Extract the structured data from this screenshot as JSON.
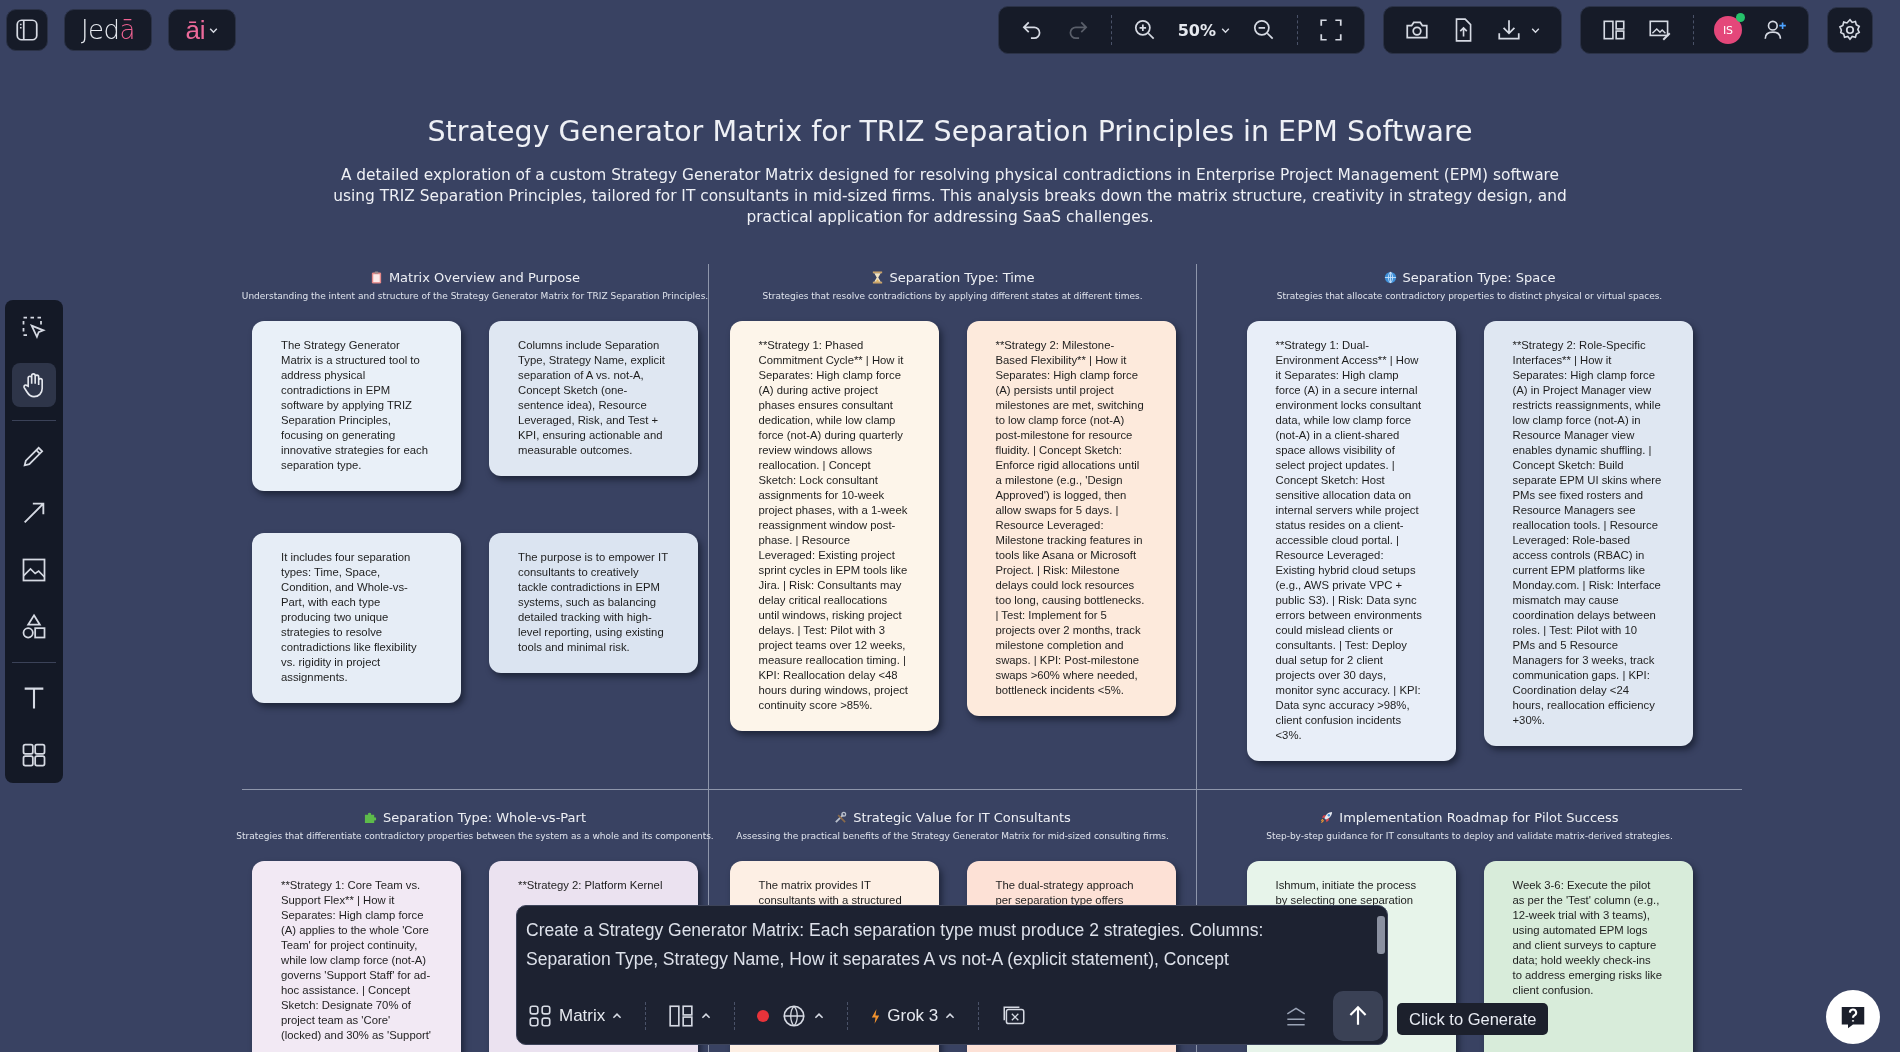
{
  "header": {
    "logo": {
      "text": "Jed",
      "accent": "ā"
    },
    "ai_label": "āi",
    "undo_disabled": false,
    "redo_disabled": true,
    "zoom": "50%",
    "avatar": "IS"
  },
  "title": "Strategy Generator Matrix for TRIZ Separation Principles in EPM Software",
  "description": "A detailed exploration of a custom Strategy Generator Matrix designed for resolving physical contradictions in Enterprise Project Management (EPM) software using TRIZ Separation Principles, tailored for IT consultants in mid-sized firms. This analysis breaks down the matrix structure, creativity in strategy design, and practical application for addressing SaaS challenges.",
  "sections": [
    {
      "title": "Matrix Overview and Purpose",
      "subtitle": "Understanding the intent and structure of the Strategy Generator Matrix for TRIZ Separation Principles.",
      "cards": [
        {
          "text": "The Strategy Generator Matrix is a structured tool to address physical contradictions in EPM software by applying TRIZ Separation Principles, focusing on generating innovative strategies for each separation type.",
          "color": "#e9f0f8"
        },
        {
          "text": "Columns include Separation Type, Strategy Name, explicit separation of A vs. not-A, Concept Sketch (one-sentence idea), Resource Leveraged, Risk, and Test + KPI, ensuring actionable and measurable outcomes.",
          "color": "#dfe7f2"
        },
        {
          "text": "It includes four separation types: Time, Space, Condition, and Whole-vs-Part, with each type producing two unique strategies to resolve contradictions like flexibility vs. rigidity in project assignments.",
          "color": "#e6edf6"
        },
        {
          "text": "The purpose is to empower IT consultants to creatively tackle contradictions in EPM systems, such as balancing detailed tracking with high-level reporting, using existing tools and minimal risk.",
          "color": "#dbe4f1"
        }
      ]
    },
    {
      "title": "Separation Type: Time",
      "subtitle": "Strategies that resolve contradictions by applying different states at different times.",
      "cards": [
        {
          "text": "**Strategy 1: Phased Commitment Cycle** | How it Separates: High clamp force (A) during active project phases ensures consultant dedication, while low clamp force (not-A) during quarterly review windows allows reallocation. | Concept Sketch: Lock consultant assignments for 10-week project phases, with a 1-week reassignment window post-phase. | Resource Leveraged: Existing project sprint cycles in EPM tools like Jira. | Risk: Consultants may delay critical reallocations until windows, risking project delays. | Test: Pilot with 3 project teams over 12 weeks, measure reallocation timing. | KPI: Reallocation delay <48 hours during windows, project continuity score >85%.",
          "color": "#fdf5ea"
        },
        {
          "text": "**Strategy 2: Milestone-Based Flexibility** | How it Separates: High clamp force (A) persists until project milestones are met, switching to low clamp force (not-A) post-milestone for resource fluidity. | Concept Sketch: Enforce rigid allocations until a milestone (e.g., 'Design Approved') is logged, then allow swaps for 5 days. | Resource Leveraged: Milestone tracking features in tools like Asana or Microsoft Project. | Risk: Milestone delays could lock resources too long, causing bottlenecks. | Test: Implement for 5 projects over 2 months, track milestone completion and swaps. | KPI: Post-milestone swaps >60% where needed, bottleneck incidents <5%.",
          "color": "#fdeadc"
        }
      ]
    },
    {
      "title": "Separation Type: Space",
      "subtitle": "Strategies that allocate contradictory properties to distinct physical or virtual spaces.",
      "cards": [
        {
          "text": "**Strategy 1: Dual-Environment Access** | How it Separates: High clamp force (A) in a secure internal environment locks consultant data, while low clamp force (not-A) in a client-shared space allows visibility of select project updates. | Concept Sketch: Host sensitive allocation data on internal servers while project status resides on a client-accessible cloud portal. | Resource Leveraged: Existing hybrid cloud setups (e.g., AWS private VPC + public S3). | Risk: Data sync errors between environments could mislead clients or consultants. | Test: Deploy dual setup for 2 client projects over 30 days, monitor sync accuracy. | KPI: Data sync accuracy >98%, client confusion incidents <3%.",
          "color": "#e8eef8"
        },
        {
          "text": "**Strategy 2: Role-Specific Interfaces** | How it Separates: High clamp force (A) in Project Manager view restricts reassignments, while low clamp force (not-A) in Resource Manager view enables dynamic shuffling. | Concept Sketch: Build separate EPM UI skins where PMs see fixed rosters and Resource Managers see reallocation tools. | Resource Leveraged: Role-based access controls (RBAC) in current EPM platforms like Monday.com. | Risk: Interface mismatch may cause coordination delays between roles. | Test: Pilot with 10 PMs and 5 Resource Managers for 3 weeks, track communication gaps. | KPI: Coordination delay <24 hours, reallocation efficiency +30%.",
          "color": "#dfe7f2"
        }
      ]
    },
    {
      "title": "Separation Type: Whole-vs-Part",
      "subtitle": "Strategies that differentiate contradictory properties between the system as a whole and its components.",
      "cards": [
        {
          "text": "**Strategy 1: Core Team vs. Support Flex** | How it Separates: High clamp force (A) applies to the whole 'Core Team' for project continuity, while low clamp force (not-A) governs 'Support Staff' for ad-hoc assistance. | Concept Sketch: Designate 70% of project team as 'Core' (locked) and 30% as 'Support'",
          "color": "#f2e9f4"
        },
        {
          "text": "**Strategy 2: Platform Kernel",
          "color": "#ebe2f0"
        }
      ]
    },
    {
      "title": "Strategic Value for IT Consultants",
      "subtitle": "Assessing the practical benefits of the Strategy Generator Matrix for mid-sized consulting firms.",
      "cards": [
        {
          "text": "The matrix provides IT consultants with a structured",
          "color": "#fdefe4"
        },
        {
          "text": "The dual-strategy approach per separation type offers",
          "color": "#fde1d6"
        }
      ]
    },
    {
      "title": "Implementation Roadmap for Pilot Success",
      "subtitle": "Step-by-step guidance for IT consultants to deploy and validate matrix-derived strategies.",
      "cards": [
        {
          "text": "Ishmum, initiate the process by selecting one separation",
          "color": "#e7f4ea"
        },
        {
          "text": "Week 3-6: Execute the pilot as per the 'Test' column (e.g., 12-week trial with 3 teams), using automated EPM logs and client surveys to capture data; hold weekly check-ins to address emerging risks like client confusion.",
          "color": "#d8ecda"
        }
      ]
    }
  ],
  "tools": [
    {
      "selected": false
    },
    {
      "selected": true
    },
    {
      "selected": false
    },
    {
      "selected": false
    },
    {
      "selected": false
    },
    {
      "selected": false
    },
    {
      "selected": false
    },
    {
      "selected": false
    }
  ],
  "prompt": {
    "lines": [
      "Create a Strategy Generator Matrix: Each separation type must produce 2 strategies. Columns:",
      "Separation Type, Strategy Name, How it separates A vs not-A (explicit statement), Concept"
    ],
    "mode": "Matrix",
    "recording": true,
    "model": "Grok 3",
    "tooltip": "Click to Generate"
  }
}
